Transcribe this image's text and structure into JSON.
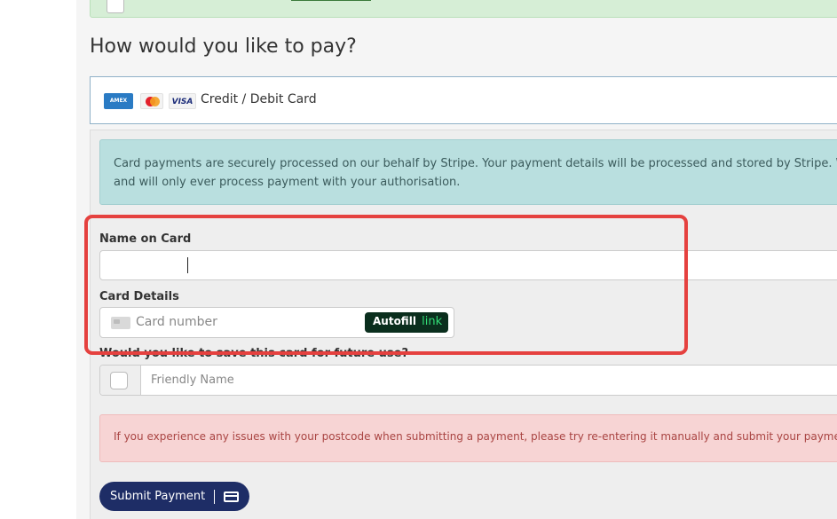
{
  "payment": {
    "heading": "How would you like to pay?",
    "method": {
      "label": "Credit / Debit Card",
      "logos": [
        "amex",
        "mastercard",
        "visa"
      ]
    },
    "info": "Card payments are securely processed on our behalf by Stripe. Your payment details will be processed and stored by Stripe. We do not",
    "info_line2": "and will only ever process payment with your authorisation.",
    "name_label": "Name on Card",
    "name_value": "",
    "card_label": "Card Details",
    "card_placeholder": "Card number",
    "autofill_label": "Autofill",
    "autofill_brand": "link",
    "save_label": "Would you like to save this card for future use?",
    "friendly_placeholder": "Friendly Name",
    "warning": "If you experience any issues with your postcode when submitting a payment, please try re-entering it manually and submit your payme",
    "submit_label": "Submit Payment"
  },
  "colors": {
    "highlight": "#e5413f",
    "submit": "#1e2d66",
    "info_bg": "#b9dfdf",
    "warning_bg": "#f7d4d4",
    "autofill_bg": "#0a2e1d",
    "link_green": "#33dd77"
  }
}
